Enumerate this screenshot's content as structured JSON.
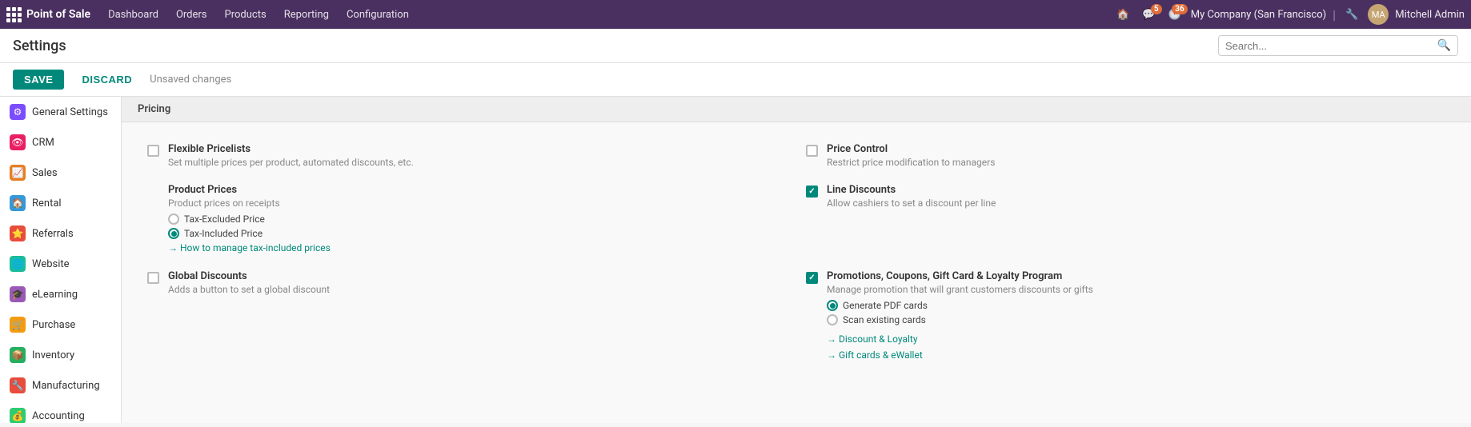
{
  "navbar": {
    "app_title": "Point of Sale",
    "menu_items": [
      {
        "label": "Dashboard"
      },
      {
        "label": "Orders"
      },
      {
        "label": "Products"
      },
      {
        "label": "Reporting"
      },
      {
        "label": "Configuration"
      }
    ],
    "chat_badge": "5",
    "activity_badge": "36",
    "company": "My Company (San Francisco)",
    "user": "Mitchell Admin",
    "search_placeholder": "Search..."
  },
  "toolbar": {
    "save_label": "SAVE",
    "discard_label": "DISCARD",
    "unsaved_message": "Unsaved changes"
  },
  "page_title": "Settings",
  "section": {
    "pricing_title": "Pricing"
  },
  "sidebar": {
    "items": [
      {
        "id": "general-settings",
        "label": "General Settings",
        "icon_class": "icon-general",
        "icon": "⚙"
      },
      {
        "id": "crm",
        "label": "CRM",
        "icon_class": "icon-crm",
        "icon": "👁"
      },
      {
        "id": "sales",
        "label": "Sales",
        "icon_class": "icon-sales",
        "icon": "📈"
      },
      {
        "id": "rental",
        "label": "Rental",
        "icon_class": "icon-rental",
        "icon": "🏠"
      },
      {
        "id": "referrals",
        "label": "Referrals",
        "icon_class": "icon-referrals",
        "icon": "⭐"
      },
      {
        "id": "website",
        "label": "Website",
        "icon_class": "icon-website",
        "icon": "🌐"
      },
      {
        "id": "elearning",
        "label": "eLearning",
        "icon_class": "icon-elearning",
        "icon": "🎓"
      },
      {
        "id": "purchase",
        "label": "Purchase",
        "icon_class": "icon-purchase",
        "icon": "🛒"
      },
      {
        "id": "inventory",
        "label": "Inventory",
        "icon_class": "icon-inventory",
        "icon": "📦"
      },
      {
        "id": "manufacturing",
        "label": "Manufacturing",
        "icon_class": "icon-manufacturing",
        "icon": "🔧"
      },
      {
        "id": "accounting",
        "label": "Accounting",
        "icon_class": "icon-accounting",
        "icon": "💰"
      }
    ]
  },
  "settings": {
    "flexible_pricelists": {
      "title": "Flexible Pricelists",
      "desc": "Set multiple prices per product, automated discounts, etc.",
      "checked": false
    },
    "price_control": {
      "title": "Price Control",
      "desc": "Restrict price modification to managers",
      "checked": false
    },
    "product_prices": {
      "title": "Product Prices",
      "desc": "Product prices on receipts",
      "tax_options": [
        {
          "label": "Tax-Excluded Price",
          "checked": false
        },
        {
          "label": "Tax-Included Price",
          "checked": true
        }
      ],
      "link_text": "How to manage tax-included prices"
    },
    "line_discounts": {
      "title": "Line Discounts",
      "desc": "Allow cashiers to set a discount per line",
      "checked": true
    },
    "global_discounts": {
      "title": "Global Discounts",
      "desc": "Adds a button to set a global discount",
      "checked": false
    },
    "promotions": {
      "title": "Promotions, Coupons, Gift Card & Loyalty Program",
      "desc": "Manage promotion that will grant customers discounts or gifts",
      "checked": true,
      "promo_options": [
        {
          "label": "Generate PDF cards",
          "checked": true
        },
        {
          "label": "Scan existing cards",
          "checked": false
        }
      ],
      "links": [
        {
          "text": "Discount & Loyalty"
        },
        {
          "text": "Gift cards & eWallet"
        }
      ]
    }
  }
}
